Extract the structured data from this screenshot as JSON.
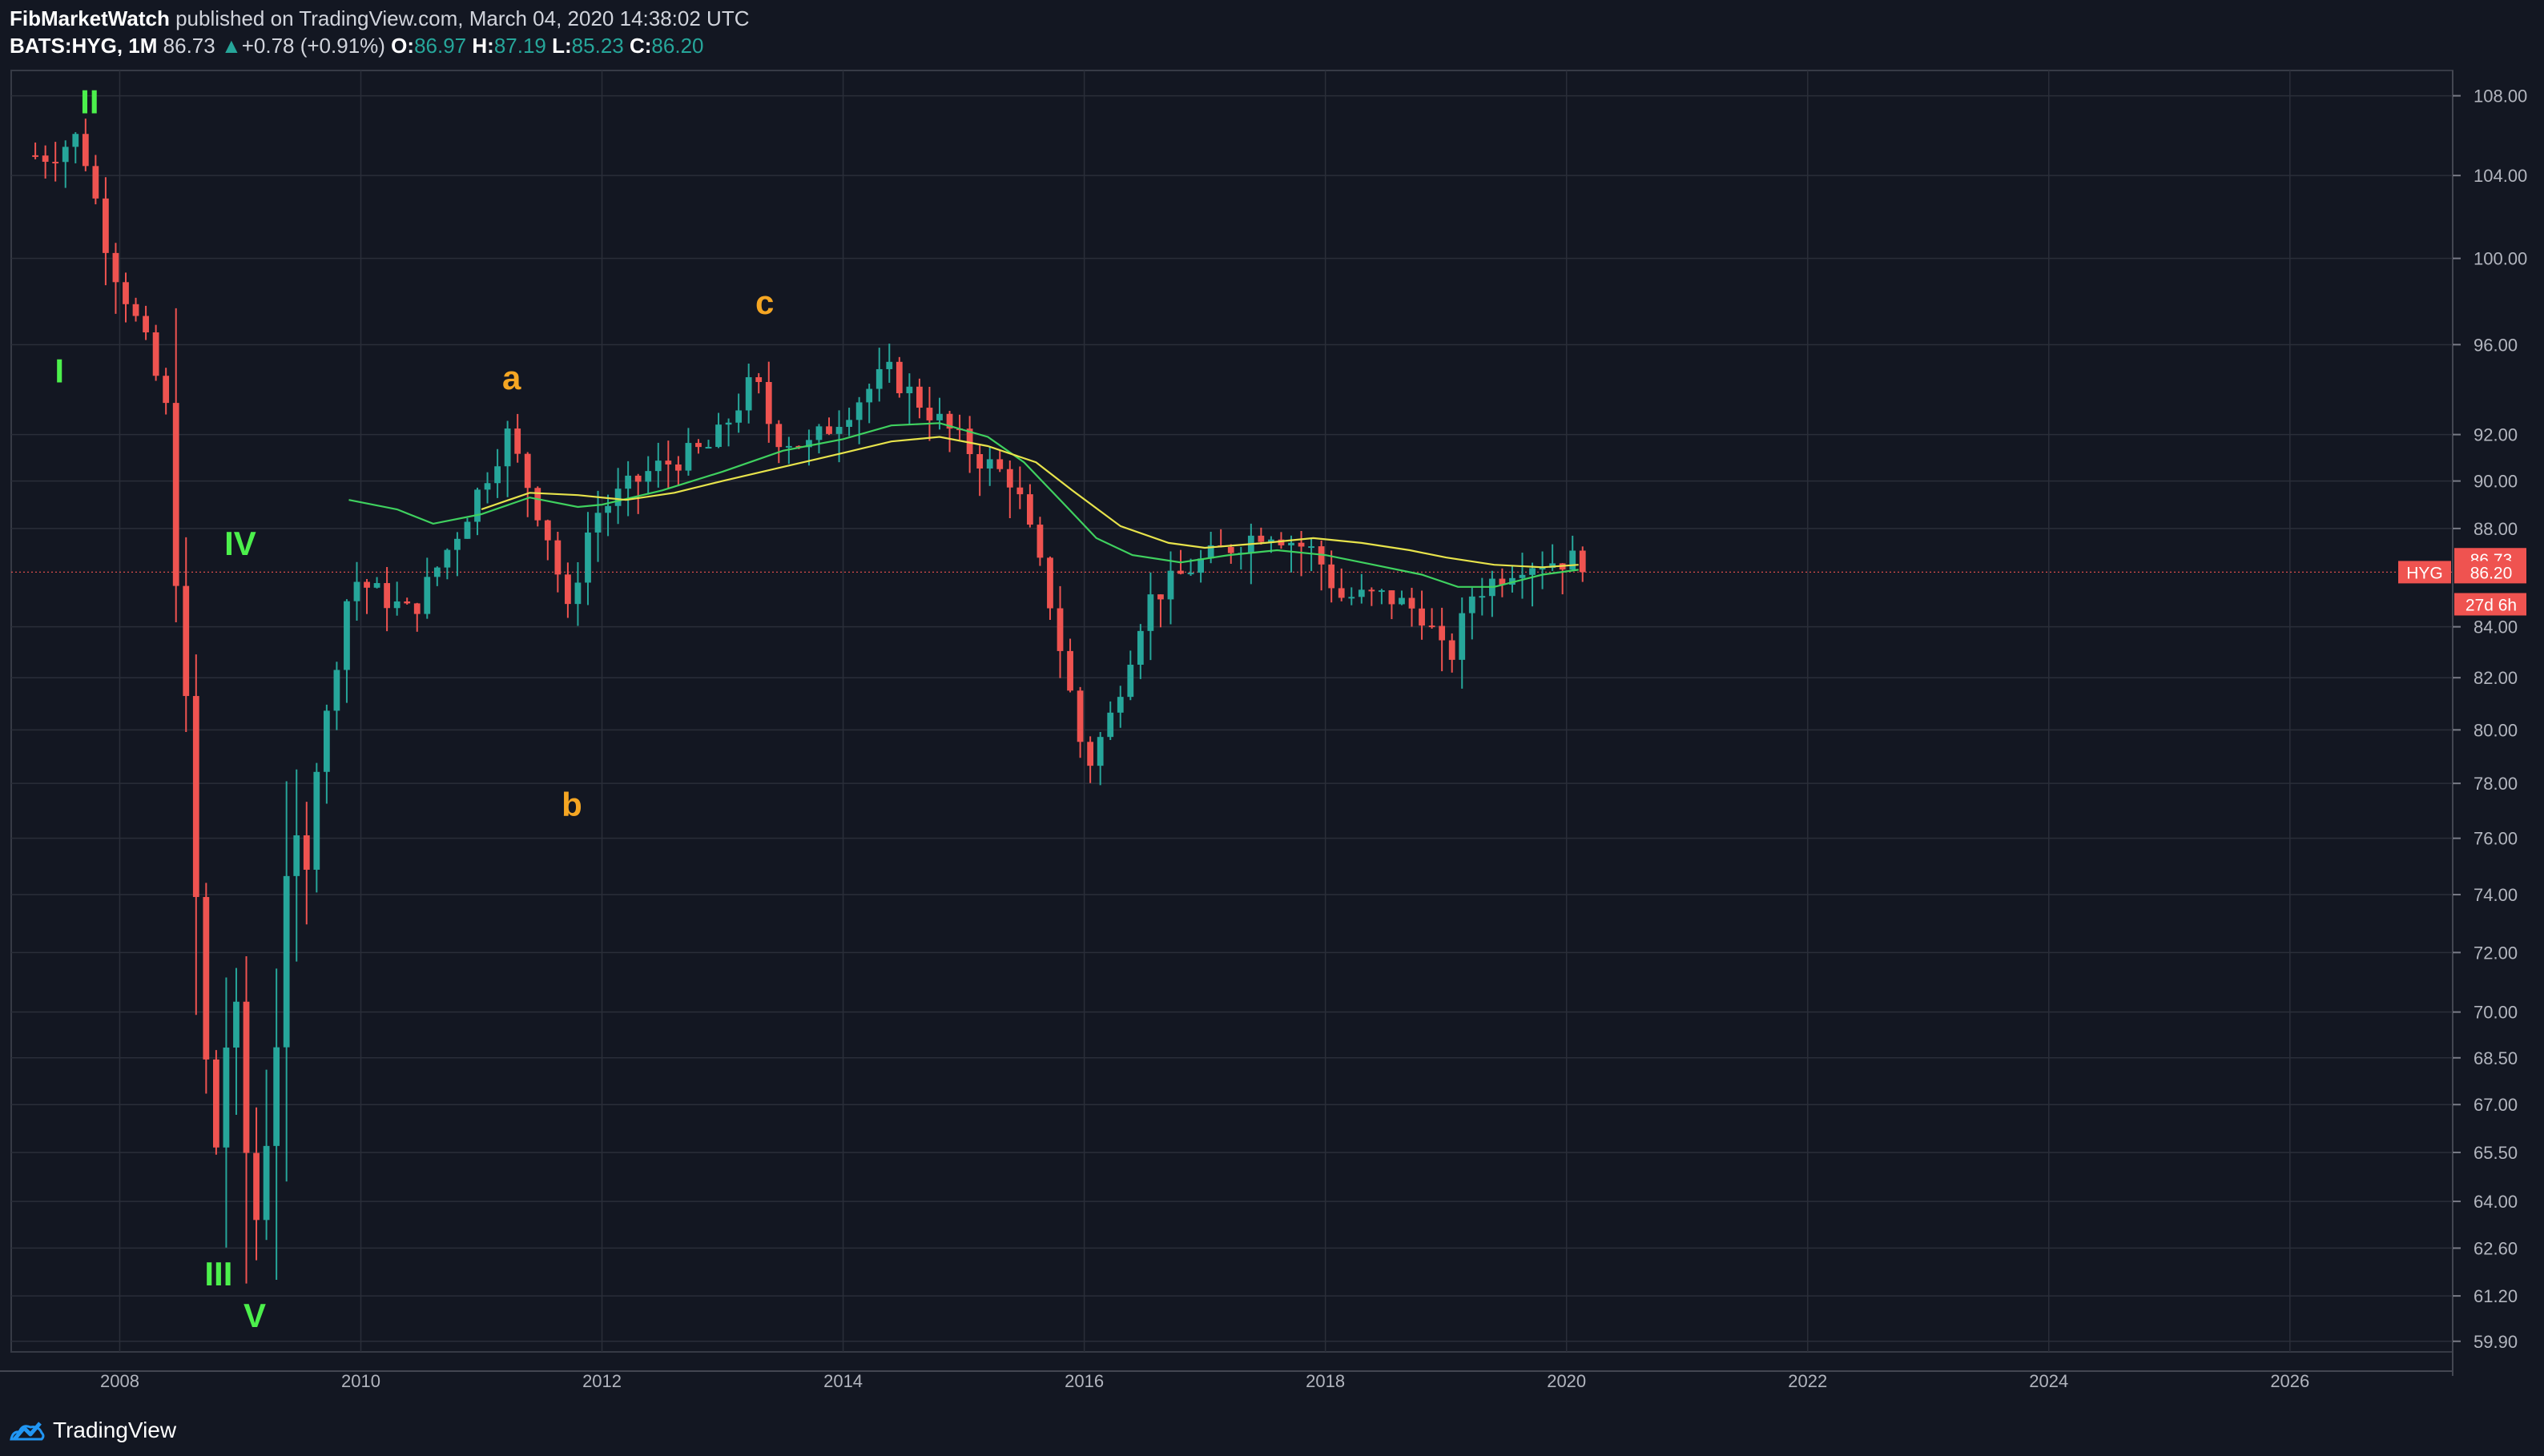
{
  "header": {
    "author": "FibMarketWatch",
    "published": "published on TradingView.com, March 04, 2020 14:38:02 UTC",
    "symbol": "BATS:HYG, 1M",
    "last": "86.73",
    "change_arrow": "▲",
    "change": "+0.78 (+0.91%)",
    "o_label": "O:",
    "o_value": "86.97",
    "h_label": "H:",
    "h_value": "87.19",
    "l_label": "L:",
    "l_value": "85.23",
    "c_label": "C:",
    "c_value": "86.20"
  },
  "footer": {
    "brand": "TradingView"
  },
  "colors": {
    "background": "#131722",
    "grid": "#2a2e39",
    "up": "#26a69a",
    "down": "#ef5350",
    "wave_green": "#4cf04c",
    "wave_orange": "#f5a623",
    "ma_fast": "#3fd15f",
    "ma_slow": "#e7e34b"
  },
  "chart_data": {
    "type": "candlestick",
    "timeframe": "1M",
    "symbol": "HYG",
    "x_range": [
      2007.1,
      2027.35
    ],
    "x_ticks": [
      "2008",
      "2010",
      "2012",
      "2014",
      "2016",
      "2018",
      "2020",
      "2022",
      "2024",
      "2026"
    ],
    "y_scale": "log",
    "y_range": [
      59.6,
      109.3
    ],
    "y_ticks": [
      "108.00",
      "104.00",
      "100.00",
      "96.00",
      "92.00",
      "90.00",
      "88.00",
      "84.00",
      "82.00",
      "80.00",
      "78.00",
      "76.00",
      "74.00",
      "72.00",
      "70.00",
      "68.50",
      "67.00",
      "65.50",
      "64.00",
      "62.60",
      "61.20",
      "59.90"
    ],
    "price_labels": [
      {
        "text": "86.73",
        "value": 86.73,
        "color": "#ef5350"
      },
      {
        "text": "86.20",
        "value": 86.2,
        "color": "#ef5350"
      },
      {
        "text": "27d 6h",
        "value": 84.9,
        "color": "#ef5350"
      }
    ],
    "symbol_tag": {
      "text": "HYG",
      "value": 86.2
    },
    "horizontal_line": 86.2,
    "moving_averages": [
      {
        "color": "#3fd15f",
        "points": [
          [
            2009.9,
            89.2
          ],
          [
            2010.3,
            88.8
          ],
          [
            2010.6,
            88.2
          ],
          [
            2011.0,
            88.6
          ],
          [
            2011.4,
            89.3
          ],
          [
            2011.8,
            88.9
          ],
          [
            2012.0,
            89.0
          ],
          [
            2012.5,
            89.6
          ],
          [
            2013.0,
            90.4
          ],
          [
            2013.5,
            91.3
          ],
          [
            2014.0,
            91.8
          ],
          [
            2014.4,
            92.4
          ],
          [
            2014.8,
            92.5
          ],
          [
            2015.2,
            91.9
          ],
          [
            2015.5,
            90.8
          ],
          [
            2015.8,
            89.2
          ],
          [
            2016.1,
            87.6
          ],
          [
            2016.4,
            86.9
          ],
          [
            2016.8,
            86.6
          ],
          [
            2017.2,
            86.9
          ],
          [
            2017.6,
            87.1
          ],
          [
            2018.0,
            86.9
          ],
          [
            2018.4,
            86.5
          ],
          [
            2018.8,
            86.1
          ],
          [
            2019.1,
            85.6
          ],
          [
            2019.4,
            85.6
          ],
          [
            2019.8,
            86.1
          ],
          [
            2020.1,
            86.3
          ]
        ]
      },
      {
        "color": "#e7e34b",
        "points": [
          [
            2011.0,
            88.8
          ],
          [
            2011.4,
            89.5
          ],
          [
            2011.8,
            89.4
          ],
          [
            2012.2,
            89.2
          ],
          [
            2012.6,
            89.5
          ],
          [
            2013.0,
            90.0
          ],
          [
            2013.5,
            90.6
          ],
          [
            2014.0,
            91.2
          ],
          [
            2014.4,
            91.7
          ],
          [
            2014.8,
            91.9
          ],
          [
            2015.2,
            91.5
          ],
          [
            2015.6,
            90.8
          ],
          [
            2015.9,
            89.6
          ],
          [
            2016.3,
            88.1
          ],
          [
            2016.7,
            87.4
          ],
          [
            2017.0,
            87.2
          ],
          [
            2017.5,
            87.4
          ],
          [
            2017.9,
            87.6
          ],
          [
            2018.3,
            87.4
          ],
          [
            2018.7,
            87.1
          ],
          [
            2019.0,
            86.8
          ],
          [
            2019.4,
            86.5
          ],
          [
            2019.8,
            86.4
          ],
          [
            2020.1,
            86.5
          ]
        ]
      }
    ],
    "anchors": [
      [
        2007.5,
        105.0
      ],
      [
        2007.75,
        106.0
      ],
      [
        2008.0,
        100.0
      ],
      [
        2008.3,
        96.0
      ],
      [
        2008.5,
        92.5
      ],
      [
        2008.65,
        78.0
      ],
      [
        2008.85,
        64.5
      ],
      [
        2009.0,
        70.5
      ],
      [
        2009.2,
        63.0
      ],
      [
        2009.5,
        74.0
      ],
      [
        2009.8,
        80.5
      ],
      [
        2010.0,
        86.0
      ],
      [
        2010.5,
        84.5
      ],
      [
        2010.9,
        88.0
      ],
      [
        2011.3,
        92.0
      ],
      [
        2011.65,
        87.5
      ],
      [
        2011.8,
        84.5
      ],
      [
        2012.0,
        88.5
      ],
      [
        2012.5,
        90.5
      ],
      [
        2013.0,
        91.5
      ],
      [
        2013.35,
        94.5
      ],
      [
        2013.5,
        92.0
      ],
      [
        2013.8,
        91.5
      ],
      [
        2014.2,
        93.5
      ],
      [
        2014.45,
        94.8
      ],
      [
        2014.8,
        93.0
      ],
      [
        2015.2,
        91.0
      ],
      [
        2015.5,
        90.0
      ],
      [
        2015.8,
        85.0
      ],
      [
        2016.1,
        78.5
      ],
      [
        2016.3,
        80.5
      ],
      [
        2016.6,
        85.0
      ],
      [
        2017.0,
        86.5
      ],
      [
        2017.6,
        88.0
      ],
      [
        2018.0,
        87.0
      ],
      [
        2018.2,
        85.2
      ],
      [
        2018.6,
        85.2
      ],
      [
        2018.9,
        84.5
      ],
      [
        2019.1,
        82.5
      ],
      [
        2019.3,
        85.3
      ],
      [
        2019.7,
        86.6
      ],
      [
        2020.1,
        86.7
      ]
    ],
    "candle_span": [
      2007.3,
      2020.15
    ],
    "wave_labels": [
      {
        "text": "I",
        "x": 2007.5,
        "y": 94.3,
        "color": "#4cf04c"
      },
      {
        "text": "II",
        "x": 2007.75,
        "y": 107.1,
        "color": "#4cf04c"
      },
      {
        "text": "III",
        "x": 2008.82,
        "y": 61.5,
        "color": "#4cf04c"
      },
      {
        "text": "IV",
        "x": 2009.0,
        "y": 86.9,
        "color": "#4cf04c"
      },
      {
        "text": "V",
        "x": 2009.12,
        "y": 60.3,
        "color": "#4cf04c"
      },
      {
        "text": "a",
        "x": 2011.25,
        "y": 94.0,
        "color": "#f5a623"
      },
      {
        "text": "b",
        "x": 2011.75,
        "y": 76.8,
        "color": "#f5a623"
      },
      {
        "text": "c",
        "x": 2013.35,
        "y": 97.4,
        "color": "#f5a623"
      }
    ]
  }
}
